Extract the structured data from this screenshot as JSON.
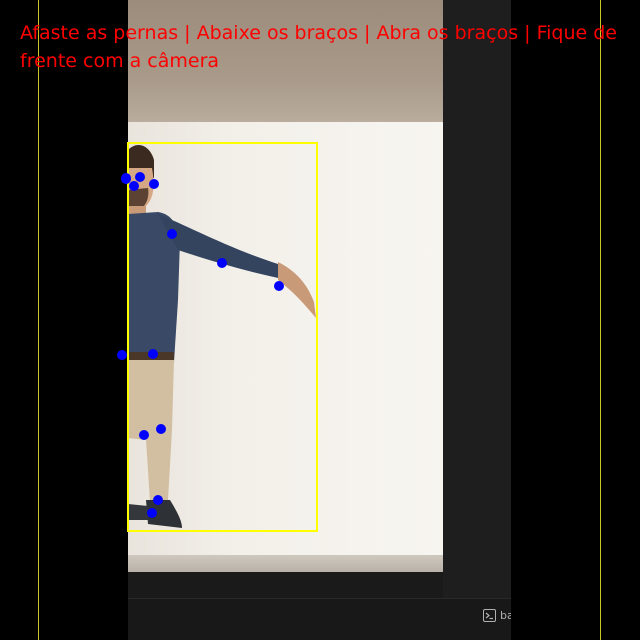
{
  "instruction_text": "Afaste as pernas | Abaixe os braços | Abra os braços | Fique de frente com a câmera",
  "terminal_tab": {
    "icon": "terminal-icon",
    "label": "ba"
  },
  "colors": {
    "instruction": "#ff0000",
    "bounding_box": "#ffff00",
    "keypoint": "#0000ff",
    "guide_line": "#c8c820"
  },
  "pose_keypoints": [
    "nose",
    "left-eye",
    "right-eye",
    "left-ear",
    "right-ear",
    "right-shoulder",
    "right-elbow",
    "right-wrist",
    "left-hip",
    "right-hip",
    "left-knee",
    "right-knee",
    "left-ankle",
    "right-ankle"
  ]
}
